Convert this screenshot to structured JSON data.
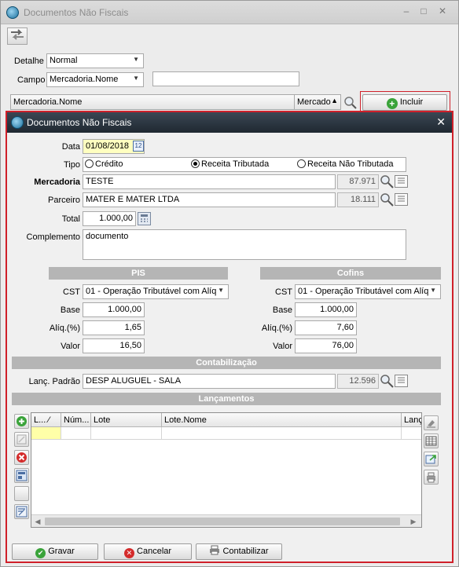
{
  "bg": {
    "title": "Documentos Não Fiscais",
    "detalhe_label": "Detalhe",
    "detalhe_value": "Normal",
    "campo_label": "Campo",
    "campo_value": "Mercadoria.Nome",
    "grid_col1": "Mercadoria.Nome",
    "grid_col2": "Mercado",
    "incluir_label": "Incluir"
  },
  "dialog": {
    "title": "Documentos Não Fiscais",
    "data_label": "Data",
    "data_value": "01/08/2018",
    "tipo_label": "Tipo",
    "tipo_options": [
      "Crédito",
      "Receita Tributada",
      "Receita Não Tributada"
    ],
    "tipo_selected": "Receita Tributada",
    "mercadoria_label": "Mercadoria",
    "mercadoria_value": "TESTE",
    "mercadoria_code": "87.971",
    "parceiro_label": "Parceiro",
    "parceiro_value": "MATER E MATER LTDA",
    "parceiro_code": "18.111",
    "total_label": "Total",
    "total_value": "1.000,00",
    "complemento_label": "Complemento",
    "complemento_value": "documento",
    "pis": {
      "header": "PIS",
      "cst_label": "CST",
      "cst_value": "01 - Operação Tributável com Alíqu",
      "base_label": "Base",
      "base_value": "1.000,00",
      "aliq_label": "Alíq.(%)",
      "aliq_value": "1,65",
      "valor_label": "Valor",
      "valor_value": "16,50"
    },
    "cofins": {
      "header": "Cofins",
      "cst_label": "CST",
      "cst_value": "01 - Operação Tributável com Alíqu",
      "base_label": "Base",
      "base_value": "1.000,00",
      "aliq_label": "Alíq.(%)",
      "aliq_value": "7,60",
      "valor_label": "Valor",
      "valor_value": "76,00"
    },
    "contab_header": "Contabilização",
    "lanc_padrao_label": "Lanç. Padrão",
    "lanc_padrao_value": "DESP ALUGUEL - SALA",
    "lanc_padrao_code": "12.596",
    "lancamentos_header": "Lançamentos",
    "grid_columns": [
      "L... ⁄",
      "Núm...",
      "Lote",
      "Lote.Nome",
      "Lanç."
    ],
    "buttons": {
      "gravar": "Gravar",
      "cancelar": "Cancelar",
      "contabilizar": "Contabilizar"
    }
  },
  "colors": {
    "dialog_border": "#d0202a",
    "section_bg": "#b5b5b5",
    "titlebar_dark": "#2a333d",
    "date_highlight": "#ffffc0"
  }
}
